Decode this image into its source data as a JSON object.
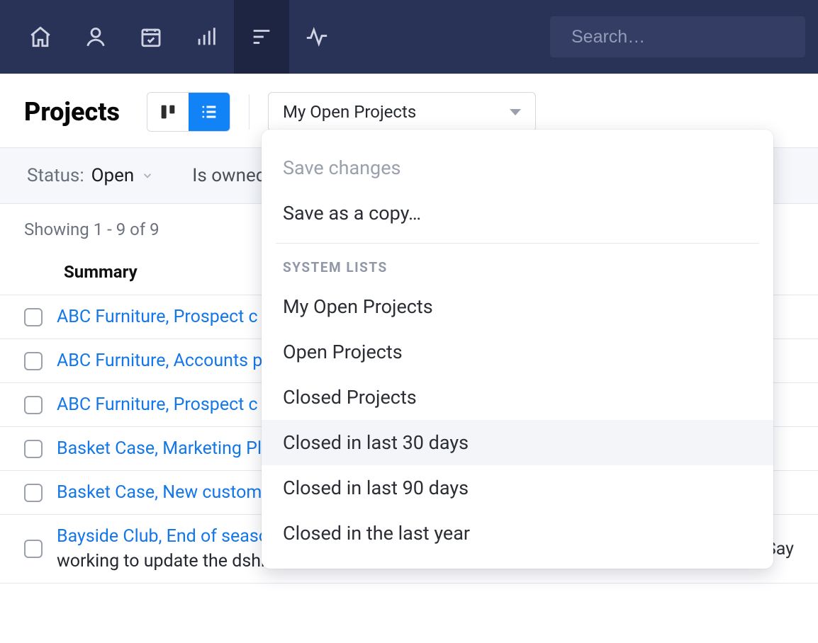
{
  "header": {
    "search_placeholder": "Search…"
  },
  "page": {
    "title": "Projects",
    "selector_value": "My Open Projects"
  },
  "filters": {
    "status_label": "Status:",
    "status_value": "Open",
    "owned_label": "Is owned"
  },
  "count_text": "Showing 1 - 9 of 9",
  "columns": {
    "summary": "Summary"
  },
  "rows": [
    {
      "summary": "ABC Furniture, Prospect c"
    },
    {
      "summary": "ABC Furniture, Accounts p"
    },
    {
      "summary": "ABC Furniture, Prospect c"
    },
    {
      "summary": "Basket Case, Marketing Pl"
    },
    {
      "summary": "Basket Case, New custom"
    },
    {
      "summary": "Bayside Club, End of season sale campaign",
      "sub": "working to update the dshboard",
      "owner": "Jade Say"
    }
  ],
  "dropdown": {
    "save_changes": "Save changes",
    "save_as_copy": "Save as a copy…",
    "section_label": "SYSTEM LISTS",
    "items": [
      "My Open Projects",
      "Open Projects",
      "Closed Projects",
      "Closed in last 30 days",
      "Closed in last 90 days",
      "Closed in the last year"
    ],
    "hover_index": 3
  }
}
